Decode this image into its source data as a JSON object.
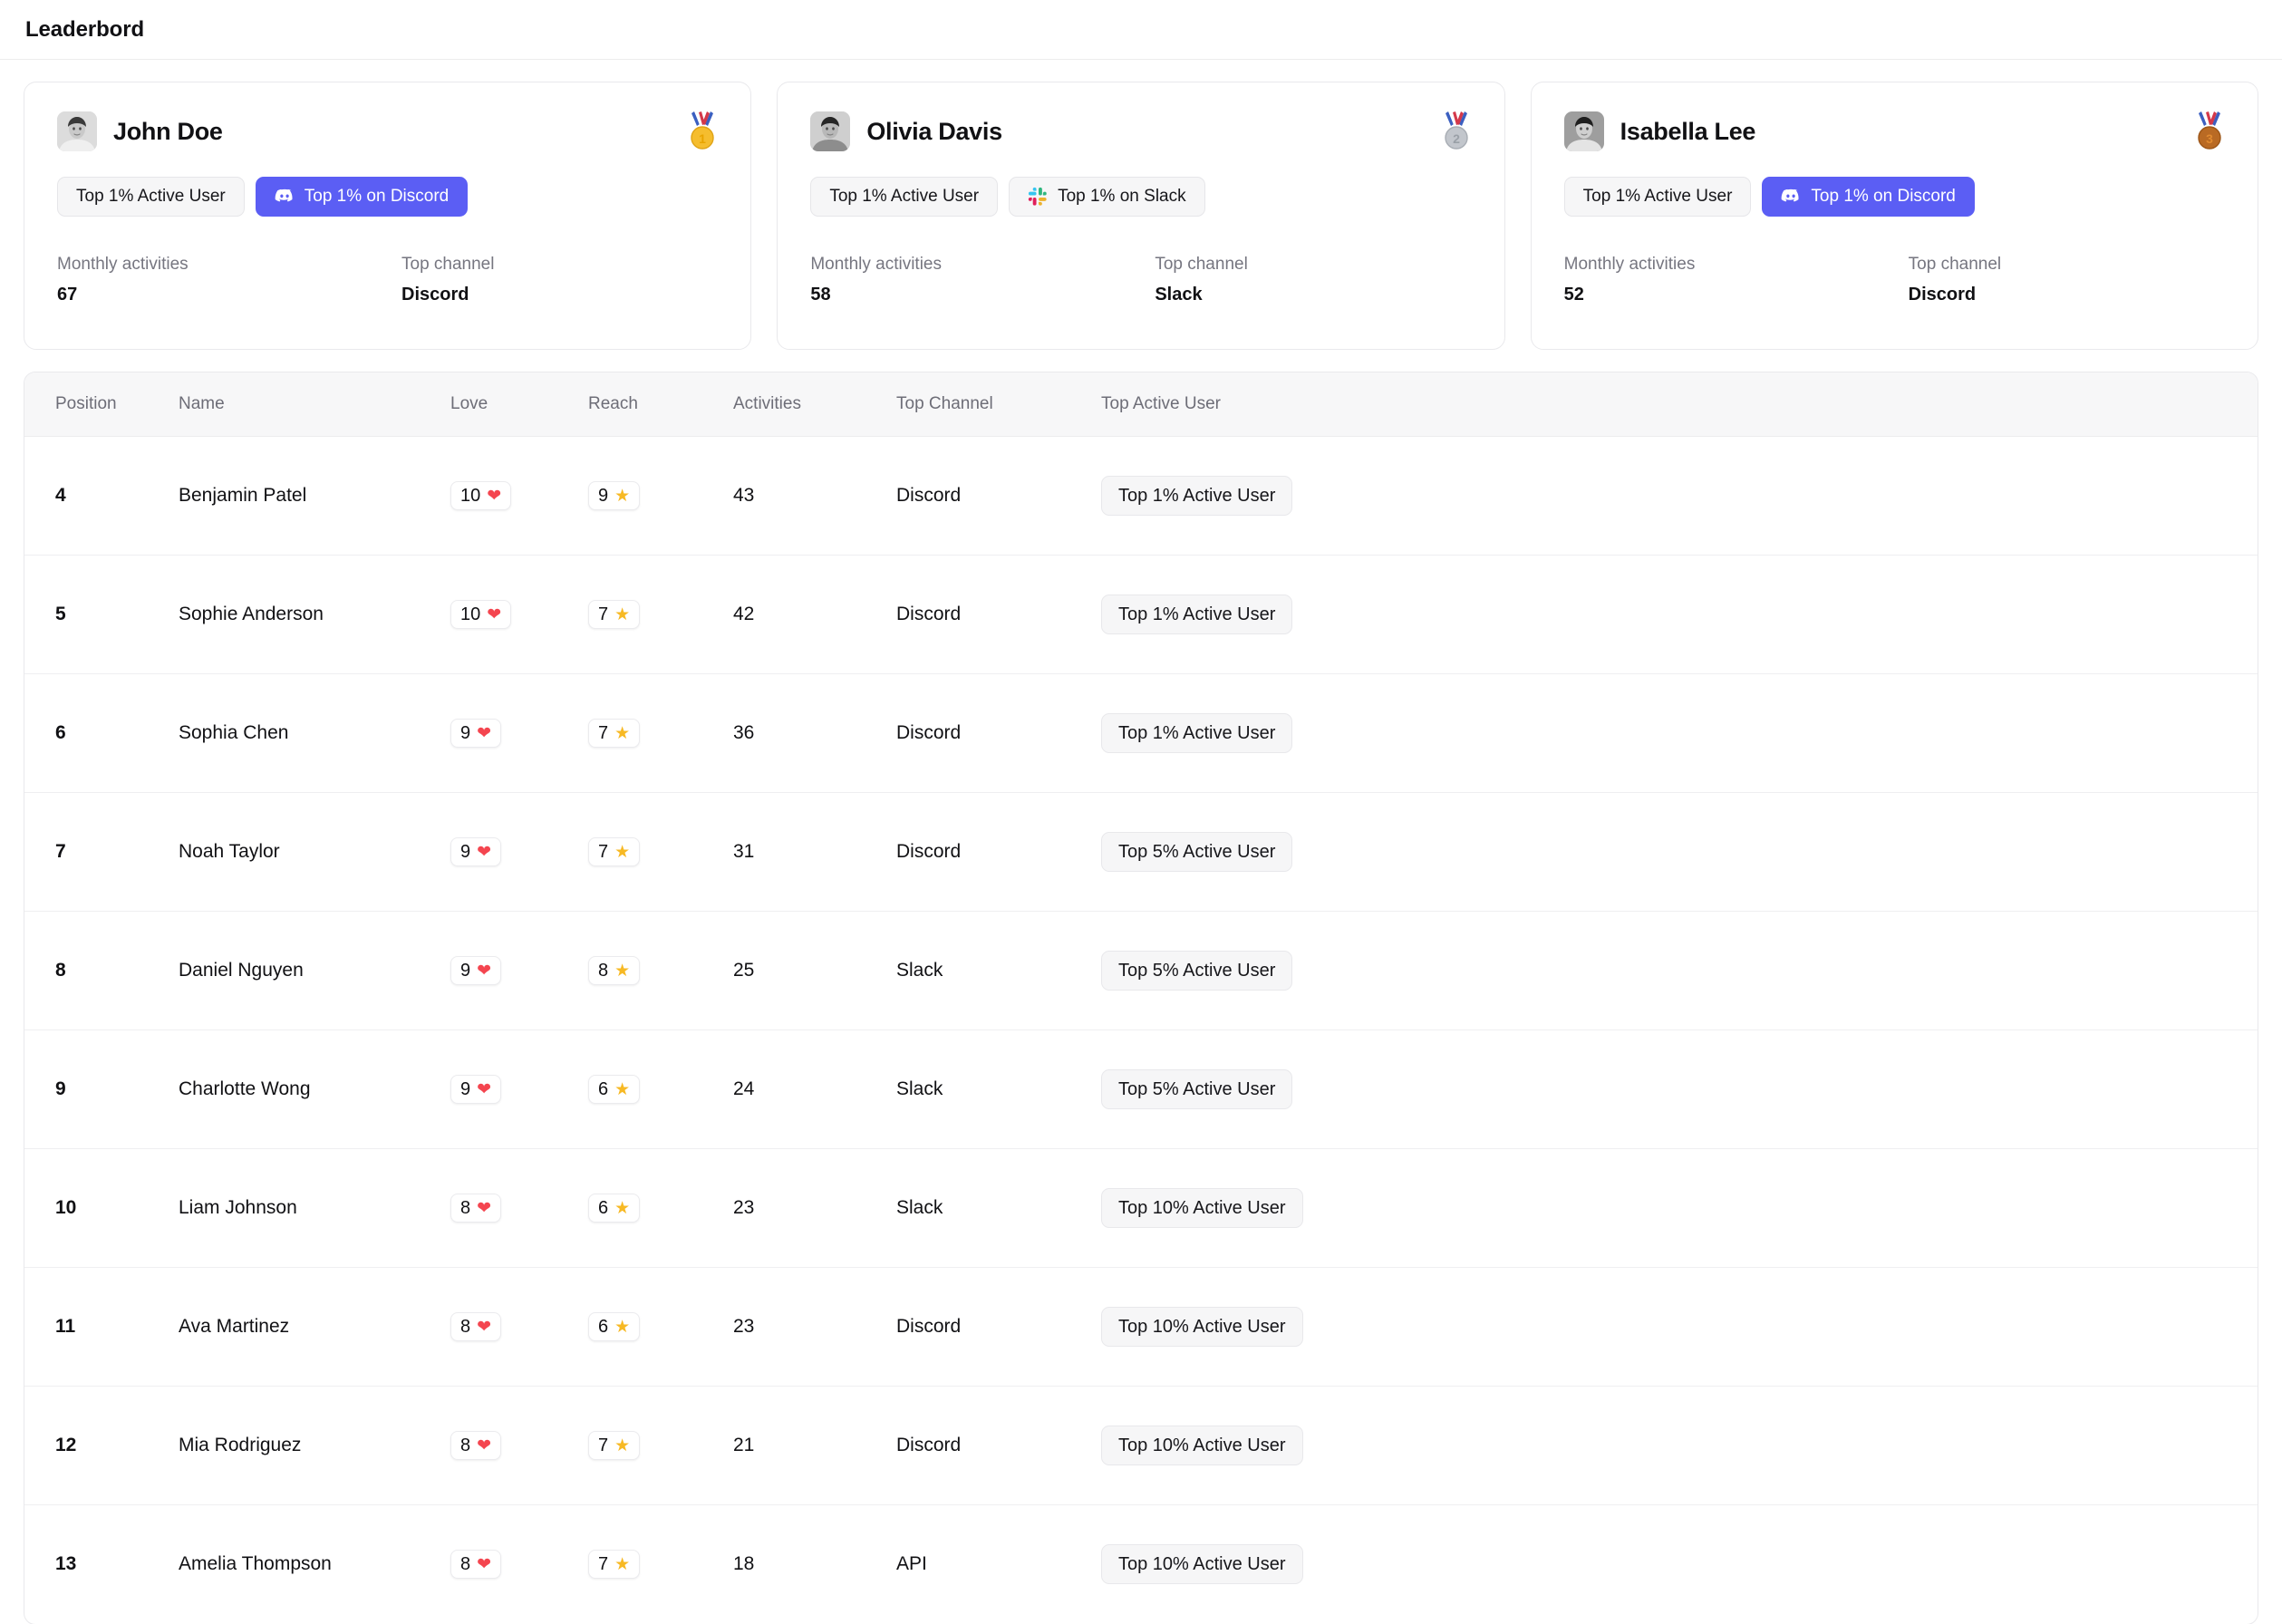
{
  "header": {
    "title": "Leaderbord"
  },
  "podium": {
    "stat_labels": {
      "monthly_activities": "Monthly activities",
      "top_channel": "Top channel"
    },
    "cards": [
      {
        "name": "John Doe",
        "medal": "gold-medal-icon",
        "medal_rank": "1",
        "badges": [
          {
            "label": "Top 1% Active User",
            "style": "neutral",
            "icon": "none"
          },
          {
            "label": "Top 1% on Discord",
            "style": "discord",
            "icon": "discord-icon"
          }
        ],
        "monthly_activities": "67",
        "top_channel": "Discord"
      },
      {
        "name": "Olivia Davis",
        "medal": "silver-medal-icon",
        "medal_rank": "2",
        "badges": [
          {
            "label": "Top 1% Active User",
            "style": "neutral",
            "icon": "none"
          },
          {
            "label": "Top 1% on Slack",
            "style": "slack",
            "icon": "slack-icon"
          }
        ],
        "monthly_activities": "58",
        "top_channel": "Slack"
      },
      {
        "name": "Isabella Lee",
        "medal": "bronze-medal-icon",
        "medal_rank": "3",
        "badges": [
          {
            "label": "Top 1% Active User",
            "style": "neutral",
            "icon": "none"
          },
          {
            "label": "Top 1% on Discord",
            "style": "discord",
            "icon": "discord-icon"
          }
        ],
        "monthly_activities": "52",
        "top_channel": "Discord"
      }
    ]
  },
  "table": {
    "columns": [
      "Position",
      "Name",
      "Love",
      "Reach",
      "Activities",
      "Top Channel",
      "Top Active User"
    ],
    "rows": [
      {
        "position": "4",
        "name": "Benjamin Patel",
        "love": "10",
        "reach": "9",
        "activities": "43",
        "top_channel": "Discord",
        "top_active_user": "Top 1% Active User"
      },
      {
        "position": "5",
        "name": "Sophie Anderson",
        "love": "10",
        "reach": "7",
        "activities": "42",
        "top_channel": "Discord",
        "top_active_user": "Top 1% Active User"
      },
      {
        "position": "6",
        "name": "Sophia Chen",
        "love": "9",
        "reach": "7",
        "activities": "36",
        "top_channel": "Discord",
        "top_active_user": "Top 1% Active User"
      },
      {
        "position": "7",
        "name": "Noah Taylor",
        "love": "9",
        "reach": "7",
        "activities": "31",
        "top_channel": "Discord",
        "top_active_user": "Top 5% Active User"
      },
      {
        "position": "8",
        "name": "Daniel Nguyen",
        "love": "9",
        "reach": "8",
        "activities": "25",
        "top_channel": "Slack",
        "top_active_user": "Top 5% Active User"
      },
      {
        "position": "9",
        "name": "Charlotte Wong",
        "love": "9",
        "reach": "6",
        "activities": "24",
        "top_channel": "Slack",
        "top_active_user": "Top 5% Active User"
      },
      {
        "position": "10",
        "name": "Liam Johnson",
        "love": "8",
        "reach": "6",
        "activities": "23",
        "top_channel": "Slack",
        "top_active_user": "Top 10% Active User"
      },
      {
        "position": "11",
        "name": "Ava Martinez",
        "love": "8",
        "reach": "6",
        "activities": "23",
        "top_channel": "Discord",
        "top_active_user": "Top 10% Active User"
      },
      {
        "position": "12",
        "name": "Mia Rodriguez",
        "love": "8",
        "reach": "7",
        "activities": "21",
        "top_channel": "Discord",
        "top_active_user": "Top 10% Active User"
      },
      {
        "position": "13",
        "name": "Amelia Thompson",
        "love": "8",
        "reach": "7",
        "activities": "18",
        "top_channel": "API",
        "top_active_user": "Top 10% Active User"
      }
    ]
  },
  "icons": {
    "heart": "❤",
    "star": "★"
  },
  "colors": {
    "discord_badge": "#5b5ef4",
    "heart_red": "#f4454f",
    "star_yellow": "#f7b924",
    "gold": "#f0b429",
    "silver": "#b9bcc2",
    "bronze": "#b5651d"
  }
}
